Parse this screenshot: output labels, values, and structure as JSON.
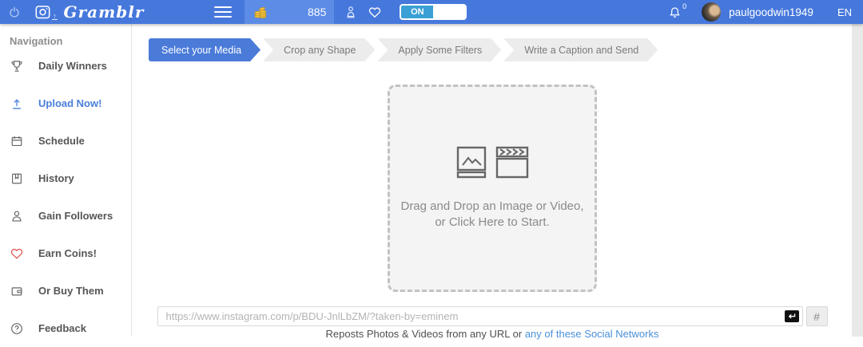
{
  "topbar": {
    "logo": "Gramblr",
    "coin_count": "885",
    "toggle_on_label": "ON",
    "notification_count": "0",
    "username": "paulgoodwin1949",
    "language": "EN",
    "icons": [
      "power-icon",
      "instagram-icon",
      "hamburger-icon",
      "coins-icon",
      "rank-icon",
      "heart-icon",
      "bell-icon",
      "avatar"
    ]
  },
  "sidebar": {
    "title": "Navigation",
    "items": [
      {
        "label": "Daily Winners",
        "icon": "trophy-icon",
        "active": false
      },
      {
        "label": "Upload Now!",
        "icon": "upload-icon",
        "active": true
      },
      {
        "label": "Schedule",
        "icon": "calendar-icon",
        "active": false
      },
      {
        "label": "History",
        "icon": "history-icon",
        "active": false
      },
      {
        "label": "Gain Followers",
        "icon": "person-icon",
        "active": false
      },
      {
        "label": "Earn Coins!",
        "icon": "heart-icon",
        "active": false
      },
      {
        "label": "Or Buy Them",
        "icon": "wallet-icon",
        "active": false
      },
      {
        "label": "Feedback",
        "icon": "question-icon",
        "active": false
      }
    ]
  },
  "steps": [
    {
      "label": "Select your Media",
      "active": true
    },
    {
      "label": "Crop any Shape",
      "active": false
    },
    {
      "label": "Apply Some Filters",
      "active": false
    },
    {
      "label": "Write a Caption and Send",
      "active": false
    }
  ],
  "dropzone": {
    "line1": "Drag and Drop an Image or Video,",
    "line2": "or Click Here to Start.",
    "icons": [
      "image-icon",
      "video-clapper-icon"
    ]
  },
  "url_bar": {
    "value": "",
    "placeholder": "https://www.instagram.com/p/BDU-JnlLbZM/?taken-by=eminem",
    "enter_icon": "enter-key-icon",
    "hash_button": "#"
  },
  "footer": {
    "text": "Reposts Photos & Videos from any URL or ",
    "link": "any of these Social Networks"
  },
  "colors": {
    "topbar_blue": "#4678dc",
    "coin_panel_blue": "#5d8ce6",
    "toggle_on": "#3aa0d6",
    "active_blue": "#4a7bd9",
    "link_blue": "#4a90d8",
    "heart_red": "#e05151",
    "step_inactive": "#ececec",
    "scroll_track": "#e9e9e9"
  }
}
